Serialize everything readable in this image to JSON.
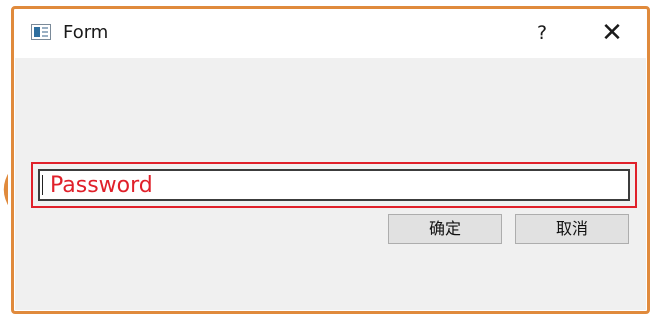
{
  "window": {
    "title": "Form",
    "help_label": "?",
    "close_label": "✕"
  },
  "form": {
    "password_placeholder": "Password",
    "ok_label": "确定",
    "cancel_label": "取消"
  },
  "colors": {
    "annotation_frame": "#e08a3c",
    "field_highlight": "#e0202a",
    "window_background": "#f0f0f0",
    "button_background": "#e1e1e1"
  },
  "icons": {
    "app": "application-window-icon",
    "help": "help-icon",
    "close": "close-icon"
  }
}
